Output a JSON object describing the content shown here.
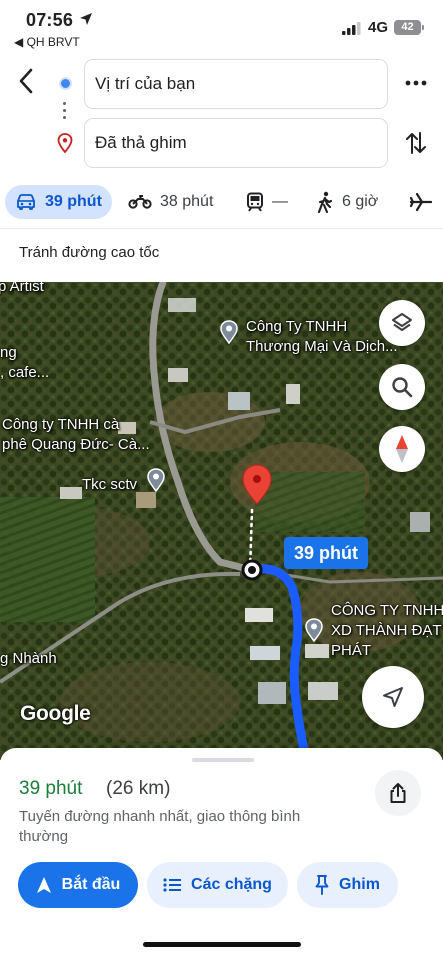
{
  "status_bar": {
    "time": "07:56",
    "back_app": "◀ QH BRVT",
    "network": "4G",
    "battery": "42"
  },
  "route": {
    "origin": "Vị trí của bạn",
    "destination": "Đã thả ghim"
  },
  "modes": [
    {
      "name": "car",
      "label": "39 phút",
      "icon": "car-icon",
      "selected": true
    },
    {
      "name": "motorbike",
      "label": "38 phút",
      "icon": "motorbike-icon"
    },
    {
      "name": "transit",
      "label": "—",
      "icon": "train-icon"
    },
    {
      "name": "walk",
      "label": "6 giờ",
      "icon": "walk-icon"
    },
    {
      "name": "flight",
      "label": "",
      "icon": "airplane-icon"
    }
  ],
  "options": {
    "avoid_label": "Tránh đường cao tốc"
  },
  "map": {
    "labels": {
      "artist": "p Artist",
      "cafe1": "ng",
      "cafe2": ", cafe...",
      "company1_l1": "Công Ty TNHH",
      "company1_l2": "Thương Mại Và Dịch...",
      "company2_l1": "Công ty TNHH cà",
      "company2_l2": "phê Quang Đức- Cà...",
      "tkc": "Tkc sctv",
      "company3_l1": "CÔNG TY TNHH",
      "company3_l2": "XD THÀNH ĐẠT",
      "company3_l3": "PHÁT",
      "nhanh": "g Nhành"
    },
    "eta_bubble": "39 phút",
    "google_logo": "Google",
    "route_color": "#1a5cff",
    "pin_color": "#ea4335"
  },
  "summary": {
    "duration": "39 phút",
    "distance": "(26 km)",
    "description": "Tuyến đường nhanh nhất, giao thông bình thường"
  },
  "actions": {
    "start": "Bắt đầu",
    "steps": "Các chặng",
    "pin": "Ghim"
  },
  "colors": {
    "accent": "#1a73e8",
    "eta_green": "#188038",
    "chip_bg": "#d3e3fd"
  }
}
